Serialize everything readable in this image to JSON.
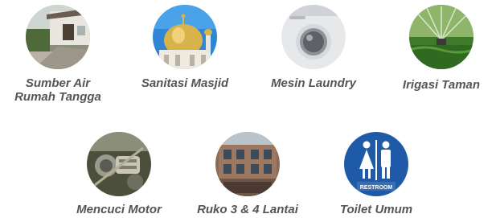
{
  "uses": [
    {
      "id": "household",
      "icon": "house-photo-icon",
      "lines": [
        "Sumber Air",
        "Rumah Tangga"
      ]
    },
    {
      "id": "mosque",
      "icon": "mosque-dome-photo-icon",
      "lines": [
        "Sanitasi Masjid"
      ]
    },
    {
      "id": "laundry",
      "icon": "washing-machine-photo-icon",
      "lines": [
        "Mesin Laundry"
      ]
    },
    {
      "id": "irrigation",
      "icon": "sprinkler-photo-icon",
      "lines": [
        "Irigasi Taman"
      ]
    },
    {
      "id": "motor",
      "icon": "motorcycle-engine-photo-icon",
      "lines": [
        "Mencuci Motor"
      ]
    },
    {
      "id": "shophouse",
      "icon": "building-photo-icon",
      "lines": [
        "Ruko 3 & 4 Lantai"
      ]
    },
    {
      "id": "toilet",
      "icon": "restroom-sign-icon",
      "lines": [
        "Toilet Umum"
      ],
      "sign_text": "RESTROOM"
    }
  ]
}
